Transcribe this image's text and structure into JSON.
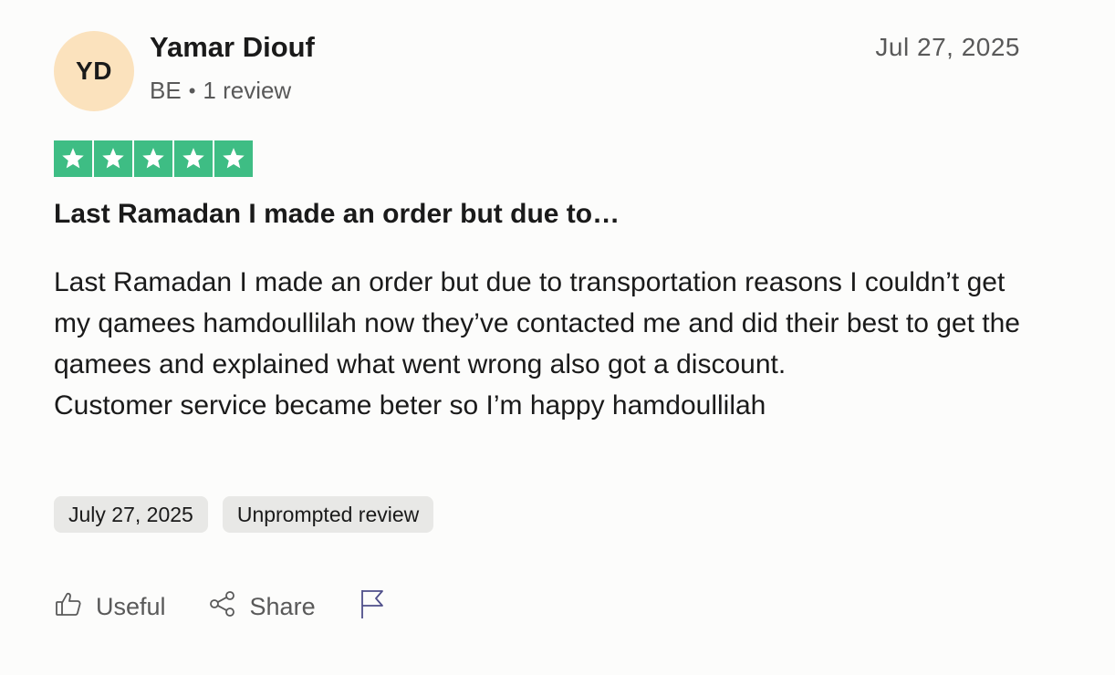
{
  "reviewer": {
    "initials": "YD",
    "name": "Yamar Diouf",
    "country": "BE",
    "separator": "•",
    "review_count": "1 review",
    "avatar_color": "#fbe2bd"
  },
  "review": {
    "date": "Jul 27, 2025",
    "rating": 5,
    "rating_max": 5,
    "star_color": "#3ebd84",
    "title": "Last Ramadan I made an order but due to…",
    "body_lines": [
      "Last Ramadan I made an order but due to transportation reasons I couldn’t get my qamees hamdoullilah now they’ve contacted me and did their best to get the qamees and explained what went wrong also got a discount.",
      "Customer service became beter so I’m happy hamdoullilah"
    ],
    "experience_date": "July 27, 2025",
    "review_type": "Unprompted review"
  },
  "actions": {
    "useful_label": "Useful",
    "share_label": "Share",
    "useful_icon": "thumbs-up-icon",
    "share_icon": "share-icon",
    "report_icon": "flag-icon"
  }
}
